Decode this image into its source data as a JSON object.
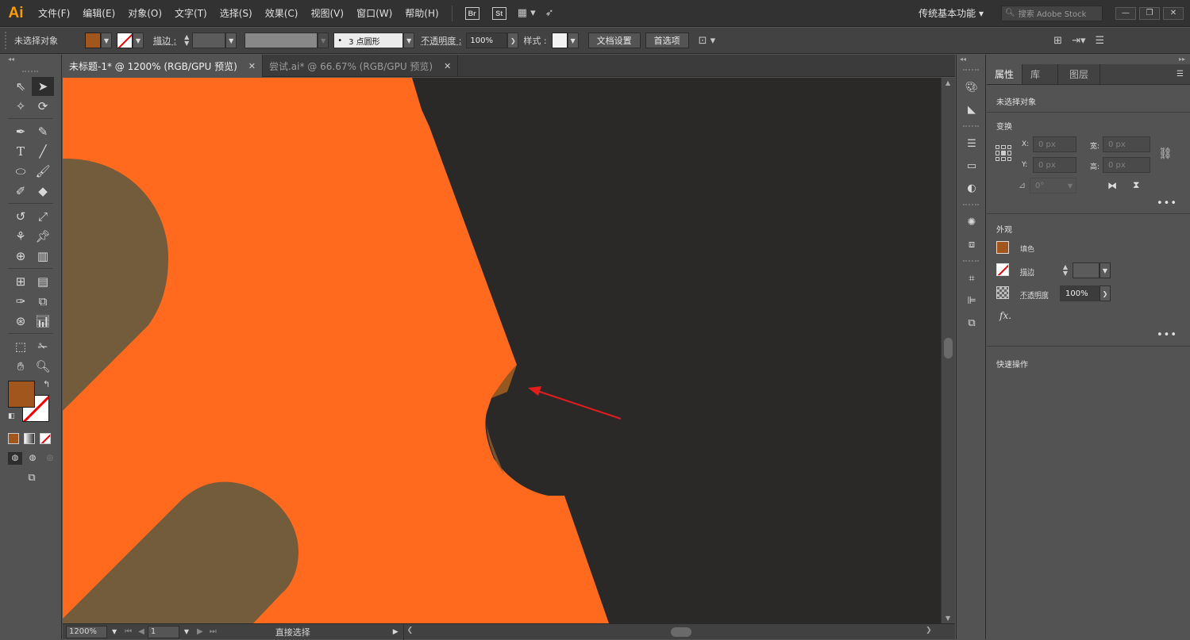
{
  "app": {
    "logo": "Ai"
  },
  "menu": [
    "文件(F)",
    "编辑(E)",
    "对象(O)",
    "文字(T)",
    "选择(S)",
    "效果(C)",
    "视图(V)",
    "窗口(W)",
    "帮助(H)"
  ],
  "menu_badges": {
    "bridge": "Br",
    "stock": "St"
  },
  "workspace": "传统基本功能",
  "search": {
    "placeholder": "搜索 Adobe Stock"
  },
  "control": {
    "selection_label": "未选择对象",
    "stroke_label": "描边 :",
    "brush_label": "3 点圆形",
    "opacity_label": "不透明度 :",
    "opacity_value": "100%",
    "style_label": "样式 :",
    "doc_setup": "文档设置",
    "preferences": "首选项"
  },
  "tabs": [
    {
      "label": "未标题-1* @ 1200% (RGB/GPU 预览)",
      "active": true
    },
    {
      "label": "尝试.ai* @ 66.67% (RGB/GPU 预览)",
      "active": false
    }
  ],
  "status": {
    "zoom": "1200%",
    "artboard": "1",
    "tool": "直接选择"
  },
  "panel": {
    "tabs": [
      "属性",
      "库",
      "图层"
    ],
    "no_selection": "未选择对象",
    "transform": {
      "title": "变换",
      "x_label": "X:",
      "y_label": "Y:",
      "w_label": "宽:",
      "h_label": "高:",
      "x": "0 px",
      "y": "0 px",
      "w": "0 px",
      "h": "0 px",
      "angle": "0°"
    },
    "appearance": {
      "title": "外观",
      "fill_label": "填色",
      "stroke_label": "描边",
      "opacity_label": "不透明度",
      "opacity_value": "100%"
    },
    "quick_actions": "快速操作"
  },
  "colors": {
    "fill": "#a0561c",
    "orange_shape": "#ff6a1e",
    "brown_circle": "#735c3b",
    "canvas_bg": "#2a2928",
    "arrow": "#e31d1d"
  }
}
